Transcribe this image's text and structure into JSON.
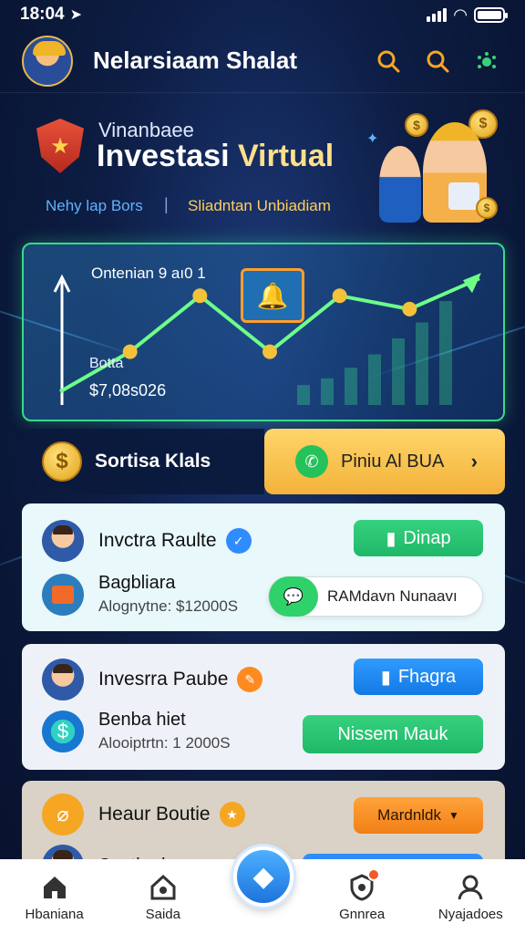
{
  "status": {
    "time": "18:04"
  },
  "header": {
    "title": "Nelarsiaam Shalat",
    "icons": [
      "search-icon",
      "search-icon",
      "bug-icon"
    ]
  },
  "hero": {
    "subtitle": "Vinanbaee",
    "title_part1": "Investasi ",
    "title_part2": "Virtual",
    "link_left": "Nehy lap Bors",
    "separator": "|",
    "link_right": "Sliadntan Unbiadiam"
  },
  "chart_card": {
    "title": "Ontenian 9 aı0 1",
    "label": "Botta",
    "value": "$7,08s026"
  },
  "chart_data": {
    "type": "line",
    "x": [
      1,
      2,
      3,
      4,
      5,
      6,
      7
    ],
    "values": [
      10,
      40,
      82,
      40,
      82,
      72,
      95
    ],
    "bars": [
      15,
      20,
      28,
      38,
      50,
      62,
      78
    ],
    "ylim": [
      0,
      100
    ]
  },
  "action_row": {
    "left_label": "Sortisa Klals",
    "right_label": "Piniu Al BUA",
    "chevron": "›"
  },
  "cards": [
    {
      "name": "Invctra Raulte",
      "badge_color": "#2f8cff",
      "button_label": "Dinap",
      "sub_title": "Bagbliara",
      "sub_meta": "Alognytne: $12000S",
      "pill_label": "RAMdavn Nunaavı"
    },
    {
      "name": "Invesrra Paube",
      "badge_color": "#ff8a1f",
      "button_label": "Fhagra",
      "sub_title": "Benba hiet",
      "sub_meta": "Alooiptrtn: 1 2000S",
      "second_button_label": "Nissem Mauk"
    },
    {
      "name": "Heaur Boutie",
      "badge_color": "#f5a623",
      "button_label": "Mardnldk",
      "sub_title": "Sontha haga"
    }
  ],
  "bottom_nav": [
    {
      "label": "Hbaniana",
      "icon": "home-icon"
    },
    {
      "label": "Saida",
      "icon": "house-outline-icon"
    },
    {
      "label": "Gnnrea",
      "icon": "shield-icon"
    },
    {
      "label": "Nyajadoes",
      "icon": "profile-icon"
    }
  ],
  "colors": {
    "accent_green": "#39d98a",
    "accent_gold": "#f3b23a",
    "background": "#0d1d44"
  }
}
